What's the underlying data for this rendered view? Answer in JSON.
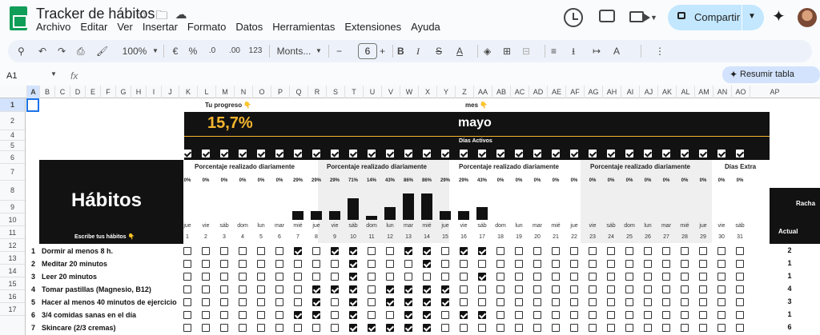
{
  "app": {
    "title": "Tracker de hábitos",
    "menu": [
      "Archivo",
      "Editar",
      "Ver",
      "Insertar",
      "Formato",
      "Datos",
      "Herramientas",
      "Extensiones",
      "Ayuda"
    ],
    "share_label": "Compartir"
  },
  "toolbar": {
    "zoom": "100%",
    "currency": "€",
    "percent": "%",
    "dec_less": ".0",
    "dec_more": ".00",
    "format_123": "123",
    "font": "Monts...",
    "font_size": "6",
    "summarize": "Resumir tabla"
  },
  "formula_bar": {
    "name_box": "A1",
    "fx": "fx",
    "formula": ""
  },
  "columns": [
    "A",
    "B",
    "C",
    "D",
    "E",
    "F",
    "G",
    "H",
    "I",
    "J",
    "K",
    "L",
    "M",
    "N",
    "O",
    "P",
    "Q",
    "R",
    "S",
    "T",
    "U",
    "V",
    "W",
    "X",
    "Y",
    "Z",
    "AA",
    "AB",
    "AC",
    "AD",
    "AE",
    "AF",
    "AG",
    "AH",
    "AI",
    "AJ",
    "AK",
    "AL",
    "AM",
    "AN",
    "AO",
    "AP"
  ],
  "rows": [
    "1",
    "2",
    "3",
    "4",
    "5",
    "6",
    "7",
    "8",
    "9",
    "10",
    "11",
    "12",
    "13",
    "14",
    "15",
    "16",
    "17"
  ],
  "sheet": {
    "progress_label": "Tu progreso 👇",
    "progress_value": "15,7%",
    "month_label": "mes 👇",
    "month_value": "mayo",
    "active_days_label": "Días Activos",
    "section_titles": [
      "Porcentaje realizado diariamente",
      "Porcentaje realizado diariamente",
      "Porcentaje realizado diariamente",
      "Porcentaje realizado diariamente",
      "Días Extra"
    ],
    "habits_title": "Hábitos",
    "habits_hint": "Escribe tus hábitos 👇",
    "streak_title": "Racha",
    "streak_current": "Actual",
    "days": [
      {
        "wd": "jue",
        "d": "1",
        "pct": "0%",
        "v": 0
      },
      {
        "wd": "vie",
        "d": "2",
        "pct": "0%",
        "v": 0
      },
      {
        "wd": "sáb",
        "d": "3",
        "pct": "0%",
        "v": 0
      },
      {
        "wd": "dom",
        "d": "4",
        "pct": "0%",
        "v": 0
      },
      {
        "wd": "lun",
        "d": "5",
        "pct": "0%",
        "v": 0
      },
      {
        "wd": "mar",
        "d": "6",
        "pct": "0%",
        "v": 0
      },
      {
        "wd": "mié",
        "d": "7",
        "pct": "29%",
        "v": 29
      },
      {
        "wd": "jue",
        "d": "8",
        "pct": "29%",
        "v": 29
      },
      {
        "wd": "vie",
        "d": "9",
        "pct": "29%",
        "v": 29
      },
      {
        "wd": "sáb",
        "d": "10",
        "pct": "71%",
        "v": 71
      },
      {
        "wd": "dom",
        "d": "11",
        "pct": "14%",
        "v": 14
      },
      {
        "wd": "lun",
        "d": "12",
        "pct": "43%",
        "v": 43
      },
      {
        "wd": "mar",
        "d": "13",
        "pct": "86%",
        "v": 86
      },
      {
        "wd": "mié",
        "d": "14",
        "pct": "86%",
        "v": 86
      },
      {
        "wd": "jue",
        "d": "15",
        "pct": "29%",
        "v": 29
      },
      {
        "wd": "vie",
        "d": "16",
        "pct": "29%",
        "v": 29
      },
      {
        "wd": "sáb",
        "d": "17",
        "pct": "43%",
        "v": 43
      },
      {
        "wd": "dom",
        "d": "18",
        "pct": "0%",
        "v": 0
      },
      {
        "wd": "lun",
        "d": "19",
        "pct": "0%",
        "v": 0
      },
      {
        "wd": "mar",
        "d": "20",
        "pct": "0%",
        "v": 0
      },
      {
        "wd": "mié",
        "d": "21",
        "pct": "0%",
        "v": 0
      },
      {
        "wd": "jue",
        "d": "22",
        "pct": "0%",
        "v": 0
      },
      {
        "wd": "vie",
        "d": "23",
        "pct": "0%",
        "v": 0
      },
      {
        "wd": "sáb",
        "d": "24",
        "pct": "0%",
        "v": 0
      },
      {
        "wd": "dom",
        "d": "25",
        "pct": "0%",
        "v": 0
      },
      {
        "wd": "lun",
        "d": "26",
        "pct": "0%",
        "v": 0
      },
      {
        "wd": "mar",
        "d": "27",
        "pct": "0%",
        "v": 0
      },
      {
        "wd": "mié",
        "d": "28",
        "pct": "0%",
        "v": 0
      },
      {
        "wd": "jue",
        "d": "29",
        "pct": "0%",
        "v": 0
      },
      {
        "wd": "vie",
        "d": "30",
        "pct": "0%",
        "v": 0
      },
      {
        "wd": "sáb",
        "d": "31",
        "pct": "0%",
        "v": 0
      }
    ],
    "habits": [
      {
        "n": "1",
        "name": "Dormir al menos 8 h.",
        "checks": [
          7,
          9,
          10,
          13,
          14,
          16,
          17
        ],
        "streak": "2"
      },
      {
        "n": "2",
        "name": "Meditar 20 minutos",
        "checks": [
          10,
          14
        ],
        "streak": "1"
      },
      {
        "n": "3",
        "name": "Leer 20 minutos",
        "checks": [
          10,
          17
        ],
        "streak": "1"
      },
      {
        "n": "4",
        "name": "Tomar pastillas (Magnesio, B12)",
        "checks": [
          8,
          9,
          10,
          12,
          13,
          14,
          15
        ],
        "streak": "4"
      },
      {
        "n": "5",
        "name": "Hacer al menos 40 minutos de ejercicio",
        "checks": [
          8,
          10,
          12,
          13,
          14,
          15
        ],
        "streak": "3"
      },
      {
        "n": "6",
        "name": "3/4 comidas sanas en el día",
        "checks": [
          7,
          8,
          10,
          13,
          14,
          16,
          17
        ],
        "streak": "1"
      },
      {
        "n": "7",
        "name": "Skincare (2/3 cremas)",
        "checks": [
          10,
          11,
          12,
          13,
          14
        ],
        "streak": "6"
      }
    ]
  }
}
